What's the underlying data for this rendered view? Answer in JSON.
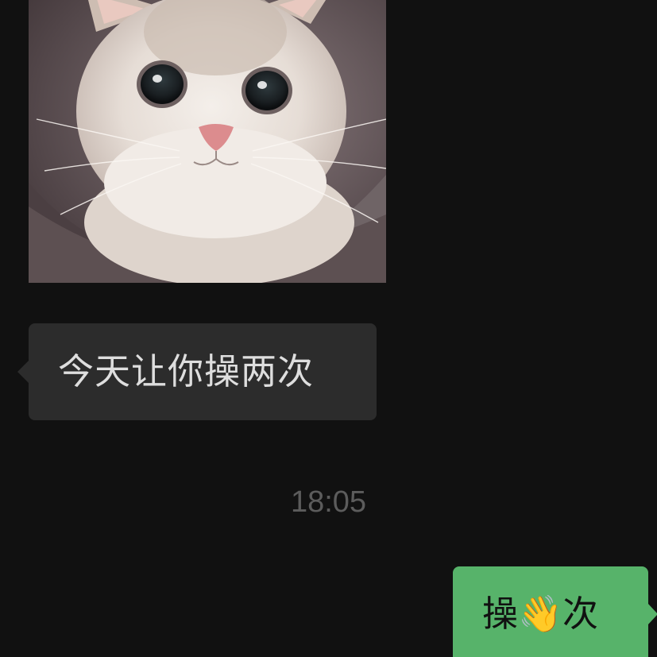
{
  "chat": {
    "messages": [
      {
        "direction": "incoming",
        "kind": "image",
        "image_subject": "cat-photo"
      },
      {
        "direction": "incoming",
        "kind": "text",
        "text": "今天让你操两次"
      },
      {
        "kind": "timestamp",
        "text": "18:05"
      },
      {
        "direction": "outgoing",
        "kind": "text",
        "text": "操👋次"
      }
    ]
  },
  "colors": {
    "background": "#111111",
    "incoming_bubble": "#2c2c2c",
    "incoming_text": "#dedede",
    "outgoing_bubble": "#57b36a",
    "outgoing_text": "#111111",
    "timestamp_text": "#5c5c5c"
  },
  "icons": {
    "outgoing_emoji": "waving-hand-icon"
  }
}
